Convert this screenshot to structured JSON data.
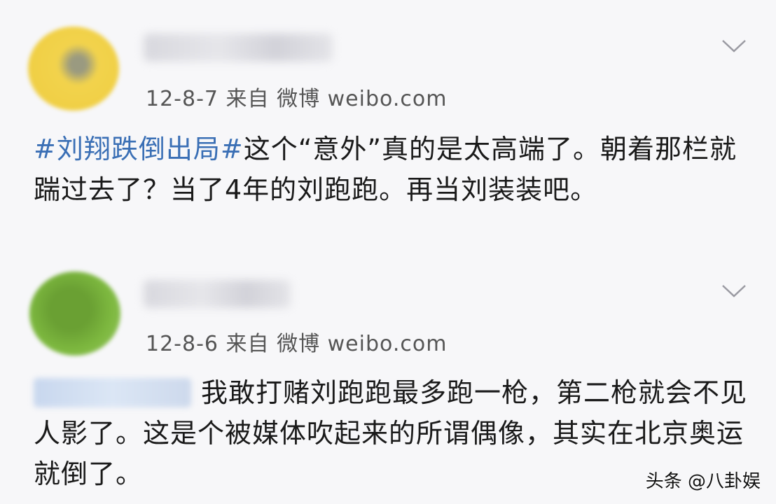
{
  "posts": [
    {
      "date": "12-8-7",
      "source": "来自 微博 weibo.com",
      "topic": "#刘翔跌倒出局#",
      "text": "这个“意外”真的是太高端了。朝着那栏就踹过去了？当了4年的刘跑跑。再当刘装装吧。"
    },
    {
      "date": "12-8-6",
      "source": "来自 微博 weibo.com",
      "text": "我敢打赌刘跑跑最多跑一枪，第二枪就会不见人影了。这是个被媒体吹起来的所谓偶像，其实在北京奥运就倒了。"
    }
  ],
  "icons": {
    "expand": "chevron-down-icon"
  },
  "colors": {
    "topic": "#3a6fb5",
    "background": "#f7f7f9"
  },
  "watermark": "头条 @八卦娱"
}
